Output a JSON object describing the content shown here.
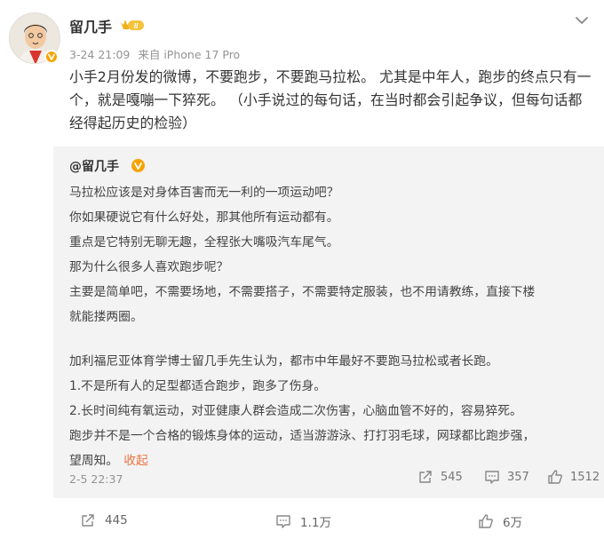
{
  "post": {
    "username": "留几手",
    "level_badge": "II",
    "timestamp": "3-24 21:09",
    "source": "来自 iPhone 17 Pro",
    "text": "小手2月份发的微博，不要跑步，不要跑马拉松。 尤其是中年人，跑步的终点只有一个，就是嘎嘣一下猝死。 （小手说过的每句话，在当时都会引起争议，但每句话都经得起历史的检验）"
  },
  "repost": {
    "author": "@留几手",
    "lines": [
      "马拉松应该是对身体百害而无一利的一项运动吧？",
      "你如果硬说它有什么好处，那其他所有运动都有。",
      "重点是它特别无聊无趣，全程张大嘴吸汽车尾气。",
      "那为什么很多人喜欢跑步呢？",
      "主要是简单吧，不需要场地，不需要搭子，不需要特定服装，也不用请教练，直接下楼",
      "就能搂两圈。",
      "",
      "加利福尼亚体育学博士留几手先生认为，都市中年最好不要跑马拉松或者长跑。",
      "1.不是所有人的足型都适合跑步，跑多了伤身。",
      "2.长时间纯有氧运动，对亚健康人群会造成二次伤害，心脑血管不好的，容易猝死。",
      "跑步并不是一个合格的锻炼身体的运动，适当游游泳、打打羽毛球，网球都比跑步强，",
      "望周知。"
    ],
    "collapse_label": "收起",
    "timestamp": "2-5 22:37",
    "repost_count": "545",
    "comment_count": "357",
    "like_count": "1512"
  },
  "footer": {
    "repost_count": "445",
    "comment_count": "1.1万",
    "like_count": "6万"
  },
  "icons": [
    "more-chevron-icon",
    "verified-v-icon",
    "crown-badge-icon",
    "repost-icon",
    "comment-icon",
    "like-icon"
  ],
  "colors": {
    "link_orange": "#eb7340",
    "verified_orange": "#f6a300",
    "repost_bg": "#f3f3f3",
    "meta_gray": "#939393"
  }
}
